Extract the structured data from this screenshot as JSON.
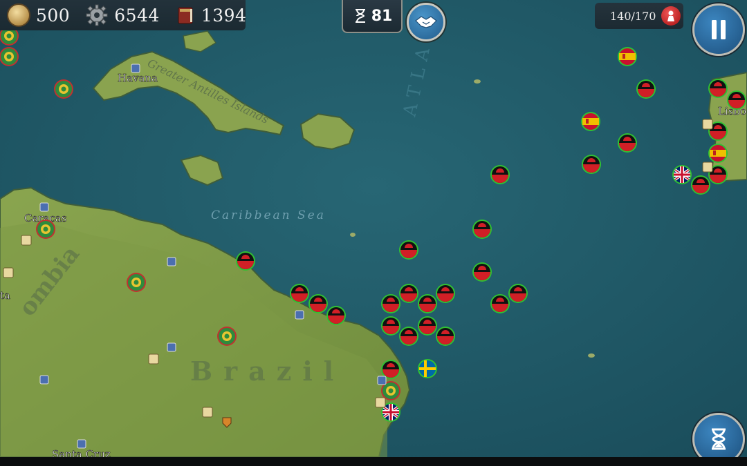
{
  "resources": {
    "gold": "500",
    "industry": "6544",
    "science": "1394"
  },
  "turn": {
    "remaining": "81"
  },
  "population": {
    "value": "140/170"
  },
  "map_labels": {
    "havana": "Havana",
    "caracas": "Caracas",
    "santa_cruz": "Santa Cruz",
    "lisbon": "Lisbo",
    "greater_antilles": "Greater Antilles Islands",
    "caribbean_sea": "Caribbean Sea",
    "brazil": "Brazil",
    "colombia": "ombia",
    "atlantic": "ATLA",
    "partial_left": "ta"
  },
  "colors": {
    "sea": "#1f5866",
    "land": "#7f9a46",
    "friendly_ring": "#30c232",
    "enemy_ring": "#c23030",
    "malawi_black": "#111111",
    "malawi_red": "#d11f26"
  },
  "icons": {
    "gold": "coin-icon",
    "industry": "gear-icon",
    "science": "book-icon",
    "diplomacy": "handshake-icon",
    "turns": "hourglass-icon",
    "population": "pawn-icon",
    "pause": "pause-icon",
    "end_turn": "hourglass-icon"
  }
}
